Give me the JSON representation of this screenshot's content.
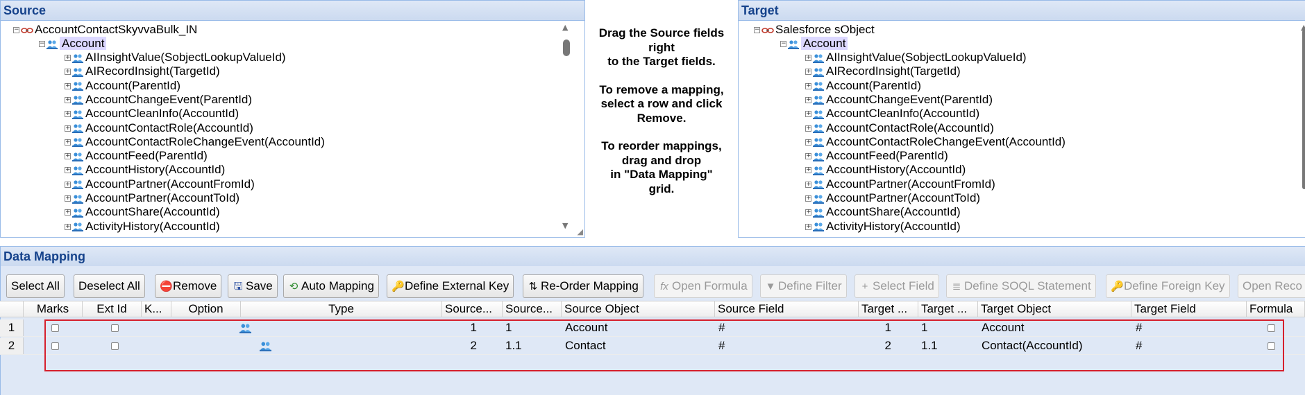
{
  "source": {
    "title": "Source",
    "root": "AccountContactSkyvvaBulk_IN",
    "object": "Account",
    "children": [
      {
        "name": "AIInsightValue",
        "rel": "(SobjectLookupValueId)"
      },
      {
        "name": "AIRecordInsight",
        "rel": "(TargetId)"
      },
      {
        "name": "Account",
        "rel": "(ParentId)"
      },
      {
        "name": "AccountChangeEvent",
        "rel": "(ParentId)"
      },
      {
        "name": "AccountCleanInfo",
        "rel": "(AccountId)"
      },
      {
        "name": "AccountContactRole",
        "rel": "(AccountId)"
      },
      {
        "name": "AccountContactRoleChangeEvent",
        "rel": "(AccountId)"
      },
      {
        "name": "AccountFeed",
        "rel": "(ParentId)"
      },
      {
        "name": "AccountHistory",
        "rel": "(AccountId)"
      },
      {
        "name": "AccountPartner",
        "rel": "(AccountFromId)"
      },
      {
        "name": "AccountPartner",
        "rel": "(AccountToId)"
      },
      {
        "name": "AccountShare",
        "rel": "(AccountId)"
      },
      {
        "name": "ActivityHistory",
        "rel": "(AccountId)"
      }
    ]
  },
  "target": {
    "title": "Target",
    "root": "Salesforce sObject",
    "object": "Account",
    "children": [
      {
        "name": "AIInsightValue",
        "rel": "(SobjectLookupValueId)"
      },
      {
        "name": "AIRecordInsight",
        "rel": "(TargetId)"
      },
      {
        "name": "Account",
        "rel": "(ParentId)"
      },
      {
        "name": "AccountChangeEvent",
        "rel": "(ParentId)"
      },
      {
        "name": "AccountCleanInfo",
        "rel": "(AccountId)"
      },
      {
        "name": "AccountContactRole",
        "rel": "(AccountId)"
      },
      {
        "name": "AccountContactRoleChangeEvent",
        "rel": "(AccountId)"
      },
      {
        "name": "AccountFeed",
        "rel": "(ParentId)"
      },
      {
        "name": "AccountHistory",
        "rel": "(AccountId)"
      },
      {
        "name": "AccountPartner",
        "rel": "(AccountFromId)"
      },
      {
        "name": "AccountPartner",
        "rel": "(AccountToId)"
      },
      {
        "name": "AccountShare",
        "rel": "(AccountId)"
      },
      {
        "name": "ActivityHistory",
        "rel": "(AccountId)"
      }
    ]
  },
  "instructions": {
    "line1": "Drag the Source fields\nright\nto the Target fields.",
    "line2": "To remove a mapping,\nselect a row and click\nRemove.",
    "line3": "To reorder mappings,\ndrag and drop\nin \"Data Mapping\"\ngrid."
  },
  "mapping": {
    "title": "Data Mapping",
    "toolbar": {
      "select_all": "Select All",
      "deselect_all": "Deselect All",
      "remove": "Remove",
      "save": "Save",
      "auto_mapping": "Auto Mapping",
      "define_external_key": "Define External Key",
      "reorder_mapping": "Re-Order Mapping",
      "open_formula": "Open Formula",
      "define_filter": "Define Filter",
      "select_field": "Select Field",
      "define_soql": "Define SOQL Statement",
      "define_foreign_key": "Define Foreign Key",
      "open_record": "Open Reco"
    },
    "columns": {
      "marks": "Marks",
      "ext_id": "Ext Id",
      "k": "K...",
      "option": "Option",
      "type": "Type",
      "source1": "Source...",
      "source2": "Source...",
      "source_object": "Source Object",
      "source_field": "Source Field",
      "target1": "Target ...",
      "target2": "Target ...",
      "target_object": "Target Object",
      "target_field": "Target Field",
      "formula": "Formula"
    },
    "rows": [
      {
        "num": "1",
        "source_level": "1",
        "source_path": "1",
        "source_object": "Account",
        "source_field": "#",
        "target_level": "1",
        "target_path": "1",
        "target_object": "Account",
        "target_field": "#"
      },
      {
        "num": "2",
        "source_level": "2",
        "source_path": "1.1",
        "source_object": "Contact",
        "source_field": "#",
        "target_level": "2",
        "target_path": "1.1",
        "target_object": "Contact(AccountId)",
        "target_field": "#"
      }
    ]
  },
  "colors": {
    "header_text": "#15428b",
    "highlight_border": "#d61f2c",
    "selected_node_bg": "#dcd8ff",
    "icon_blue": "#3a8fd9"
  }
}
